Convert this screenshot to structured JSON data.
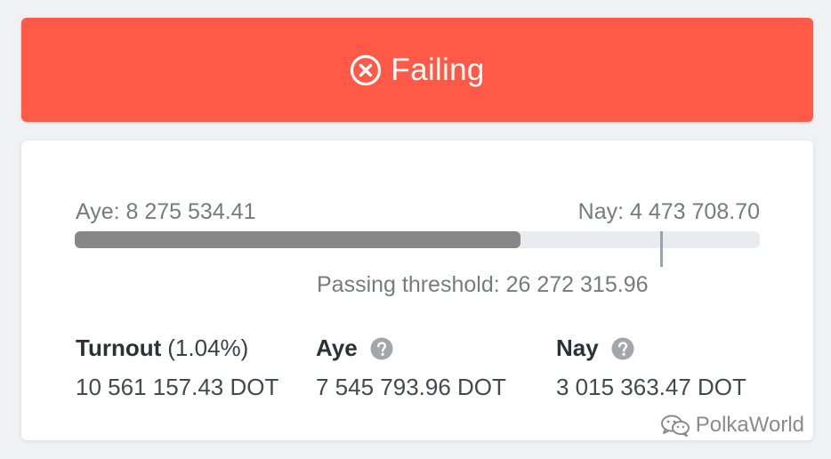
{
  "status": {
    "label": "Failing",
    "icon": "close-circle-icon",
    "color": "#ff5a47"
  },
  "tally": {
    "aye_label": "Aye: 8 275 534.41",
    "nay_label": "Nay: 4 473 708.70",
    "aye_progress_percent": 65,
    "threshold_label": "Passing threshold: 26 272 315.96",
    "threshold_percent": 93.5
  },
  "stats": {
    "turnout": {
      "title": "Turnout",
      "percent": "(1.04%)",
      "value": "10 561 157.43 DOT"
    },
    "aye": {
      "title": "Aye",
      "value": "7 545 793.96 DOT",
      "icon": "help-icon"
    },
    "nay": {
      "title": "Nay",
      "value": "3 015 363.47 DOT",
      "icon": "help-icon"
    }
  },
  "watermark": {
    "text": "PolkaWorld",
    "icon": "wechat-icon"
  },
  "colors": {
    "failing_red": "#ff5a47",
    "aye_bar": "#878787",
    "track": "#e9ecef"
  }
}
